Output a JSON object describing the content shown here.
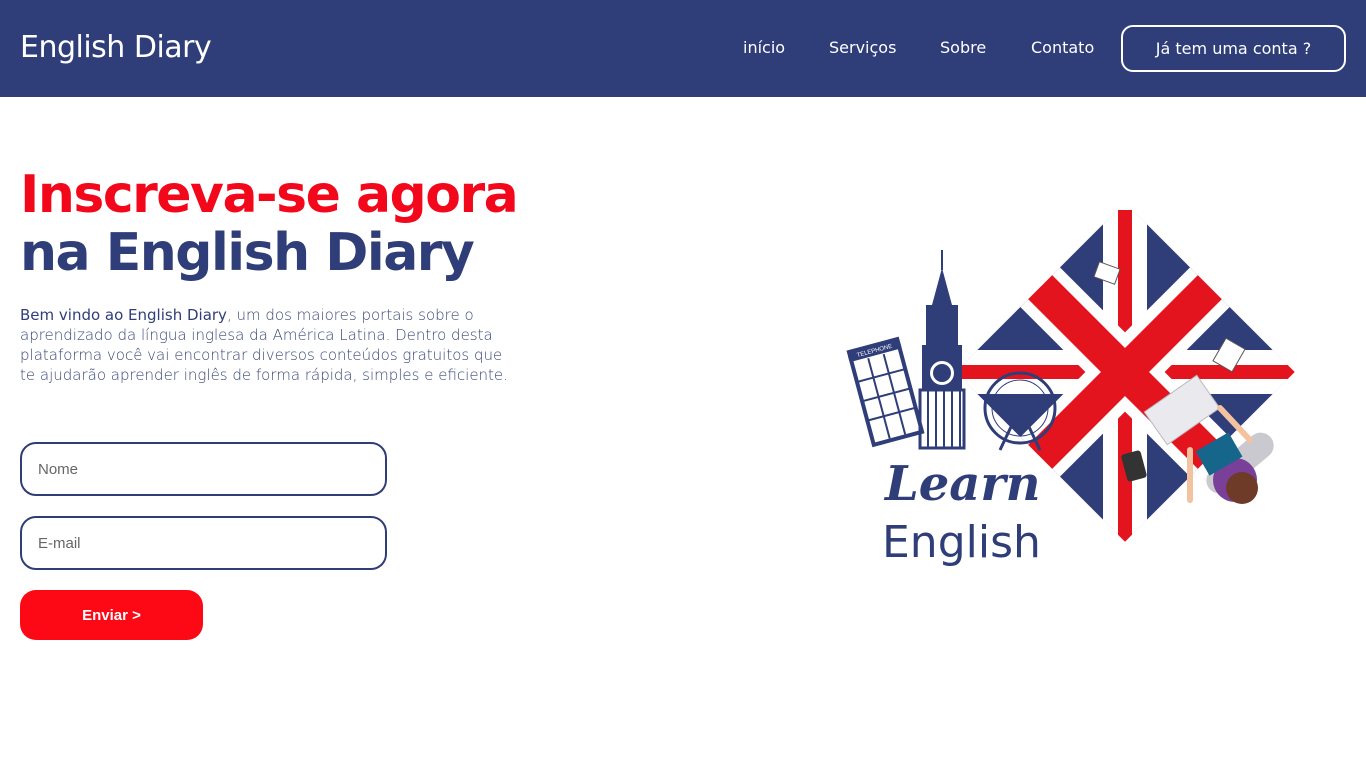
{
  "header": {
    "brand": "English Diary",
    "nav": [
      {
        "label": "início"
      },
      {
        "label": "Serviços"
      },
      {
        "label": "Sobre"
      },
      {
        "label": "Contato"
      }
    ],
    "login_button": "Já tem uma conta ?"
  },
  "hero": {
    "title_line1": "Inscreva-se agora",
    "title_line2": "na English Diary",
    "intro_lead": "Bem vindo ao English Diary",
    "intro_rest": ", um dos maiores portais sobre o aprendizado da língua inglesa da América Latina. Dentro desta plataforma você vai encontrar diversos conteúdos gratuitos que te ajudarão aprender inglês de forma rápida, simples e eficiente."
  },
  "form": {
    "name_placeholder": "Nome",
    "email_placeholder": "E-mail",
    "name_value": "",
    "email_value": "",
    "submit_label": "Enviar >"
  },
  "illustration": {
    "word1": "Learn",
    "word2": "English",
    "booth_sign": "TELEPHONE"
  },
  "colors": {
    "navy": "#2f3d78",
    "red": "#f2071b",
    "button_red": "#fd0815",
    "white": "#ffffff"
  }
}
